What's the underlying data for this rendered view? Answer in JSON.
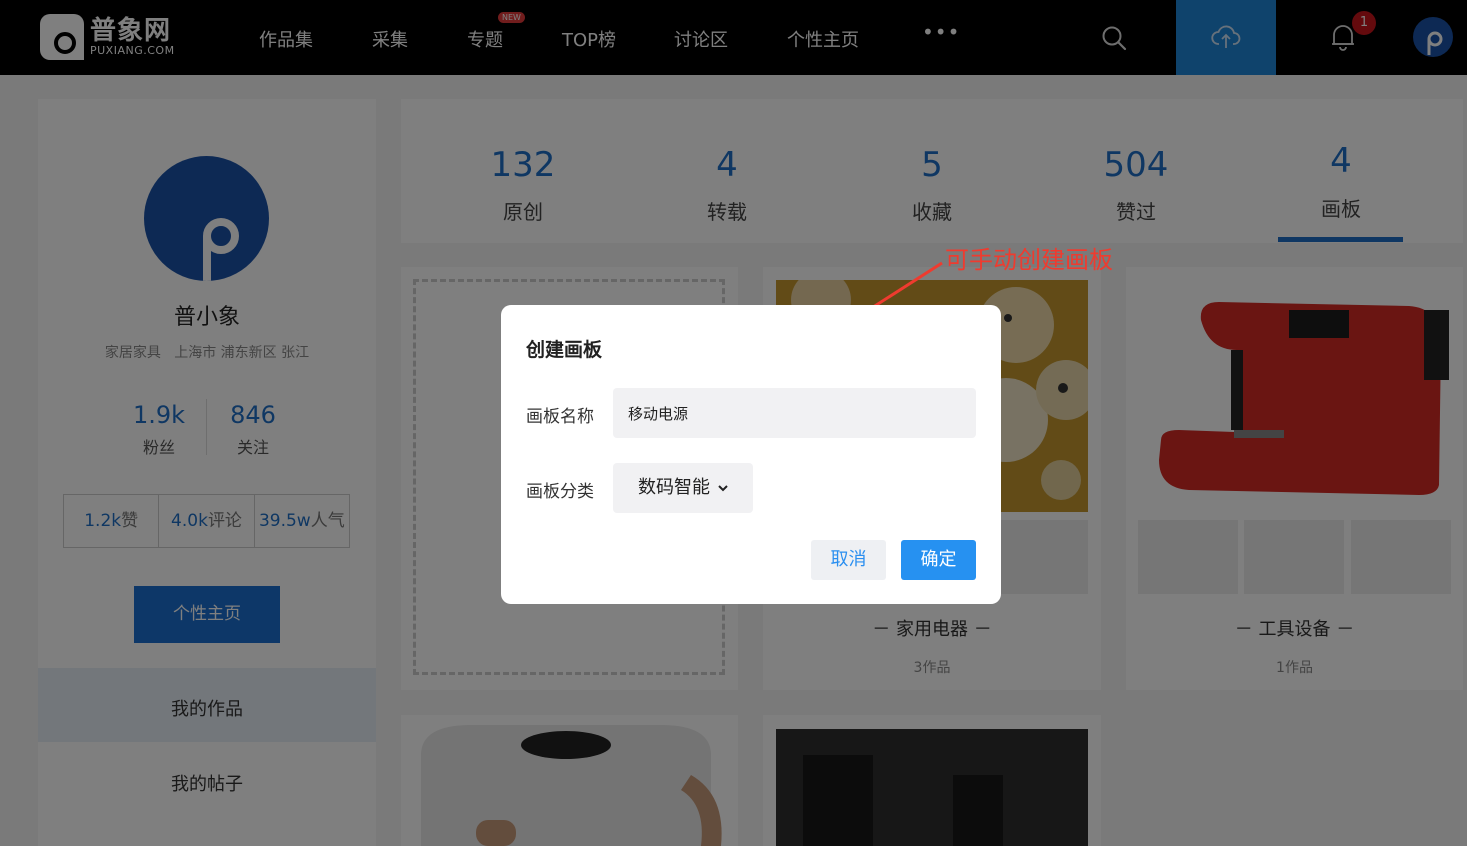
{
  "header": {
    "logo_name": "普象网",
    "logo_sub": "PUXIANG.COM",
    "nav": [
      "作品集",
      "采集",
      "专题",
      "TOP榜",
      "讨论区",
      "个性主页"
    ],
    "new_badge": "NEW",
    "more": "•••",
    "notification_count": "1"
  },
  "profile": {
    "name": "普小象",
    "info": "家居家具   上海市 浦东新区 张江",
    "fans_num": "1.9k",
    "fans_label": "粉丝",
    "follow_num": "846",
    "follow_label": "关注",
    "likes_num": "1.2k",
    "likes_unit": "赞",
    "comments_num": "4.0k",
    "comments_unit": "评论",
    "popularity_num": "39.5w",
    "popularity_unit": "人气",
    "home_button": "个性主页",
    "menu": [
      "我的作品",
      "我的帖子"
    ]
  },
  "stats": [
    {
      "num": "132",
      "label": "原创"
    },
    {
      "num": "4",
      "label": "转载"
    },
    {
      "num": "5",
      "label": "收藏"
    },
    {
      "num": "504",
      "label": "赞过"
    },
    {
      "num": "4",
      "label": "画板"
    }
  ],
  "boards": [
    {
      "title": "－ 家用电器 －",
      "count": "3作品"
    },
    {
      "title": "－ 工具设备 －",
      "count": "1作品"
    }
  ],
  "annotation": "可手动创建画板",
  "modal": {
    "title": "创建画板",
    "name_label": "画板名称",
    "name_value": "移动电源",
    "category_label": "画板分类",
    "category_value": "数码智能",
    "cancel": "取消",
    "confirm": "确定"
  },
  "colors": {
    "accent": "#1f6fc6",
    "annotation": "#ef3b2f",
    "primary_button": "#2691f1"
  }
}
